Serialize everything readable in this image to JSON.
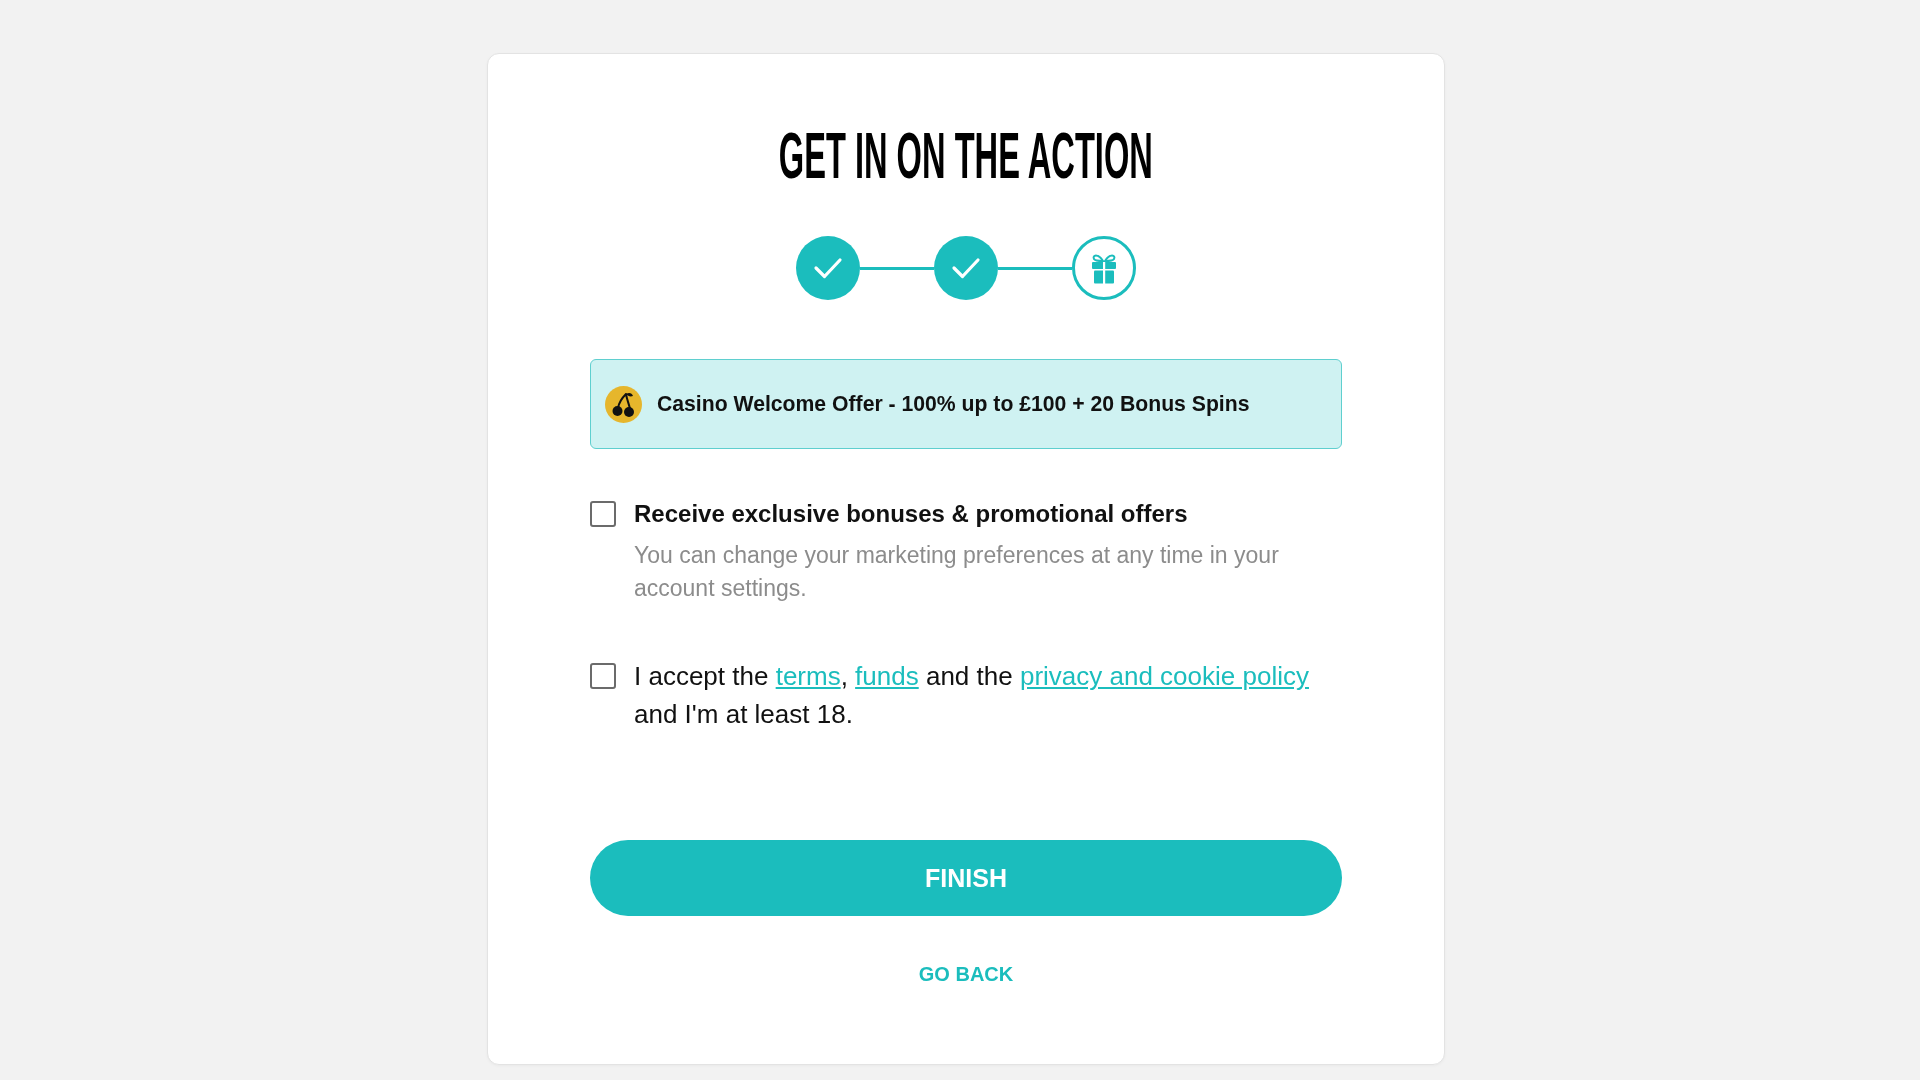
{
  "title": "GET IN ON THE ACTION",
  "steps": [
    {
      "completed": true
    },
    {
      "completed": true
    },
    {
      "completed": false
    }
  ],
  "offer": {
    "text": "Casino Welcome Offer - 100% up to £100 + 20 Bonus Spins"
  },
  "options": [
    {
      "kind": "labelled",
      "checked": false,
      "label": "Receive exclusive bonuses & promotional offers",
      "note": "You can change your marketing preferences at any time in your account settings."
    },
    {
      "kind": "consent",
      "checked": false,
      "parts": [
        {
          "kind": "text",
          "text": "I accept the "
        },
        {
          "kind": "link",
          "text": "terms"
        },
        {
          "kind": "text",
          "text": ", "
        },
        {
          "kind": "link",
          "text": "funds"
        },
        {
          "kind": "text",
          "text": " and the "
        },
        {
          "kind": "link",
          "text": "privacy and cookie policy"
        },
        {
          "kind": "text",
          "text": " and I'm at least 18."
        }
      ]
    }
  ],
  "finish_button": {
    "label": "FINISH"
  },
  "go_back_link": {
    "label": "GO BACK"
  }
}
